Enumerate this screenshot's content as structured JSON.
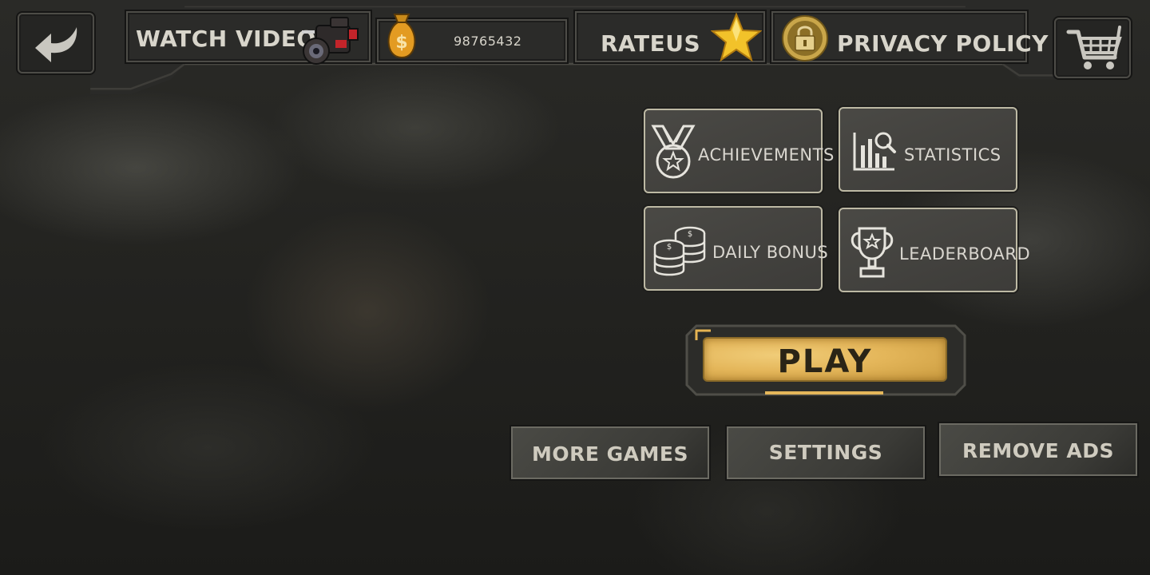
{
  "topbar": {
    "watch_video_label": "WATCH VIDEO",
    "coins": "98765432",
    "rate_label": "RATEUS",
    "privacy_label": "PRIVACY POLICY"
  },
  "menu": {
    "achievements": "ACHIEVEMENTS",
    "statistics": "STATISTICS",
    "daily_bonus": "DAILY BONUS",
    "leaderboard": "LEADERBOARD"
  },
  "play_label": "PLAY",
  "bottom": {
    "more_games": "MORE GAMES",
    "settings": "SETTINGS",
    "remove_ads": "REMOVE ADS"
  },
  "icons": [
    "back-arrow-icon",
    "video-camera-icon",
    "money-bag-icon",
    "star-icon",
    "lock-icon",
    "cart-icon",
    "medal-icon",
    "chart-search-icon",
    "coins-icon",
    "trophy-icon"
  ],
  "colors": {
    "play_gold": "#e4b65a",
    "card_border": "#bdb9a4",
    "star": "#f2c22a"
  }
}
